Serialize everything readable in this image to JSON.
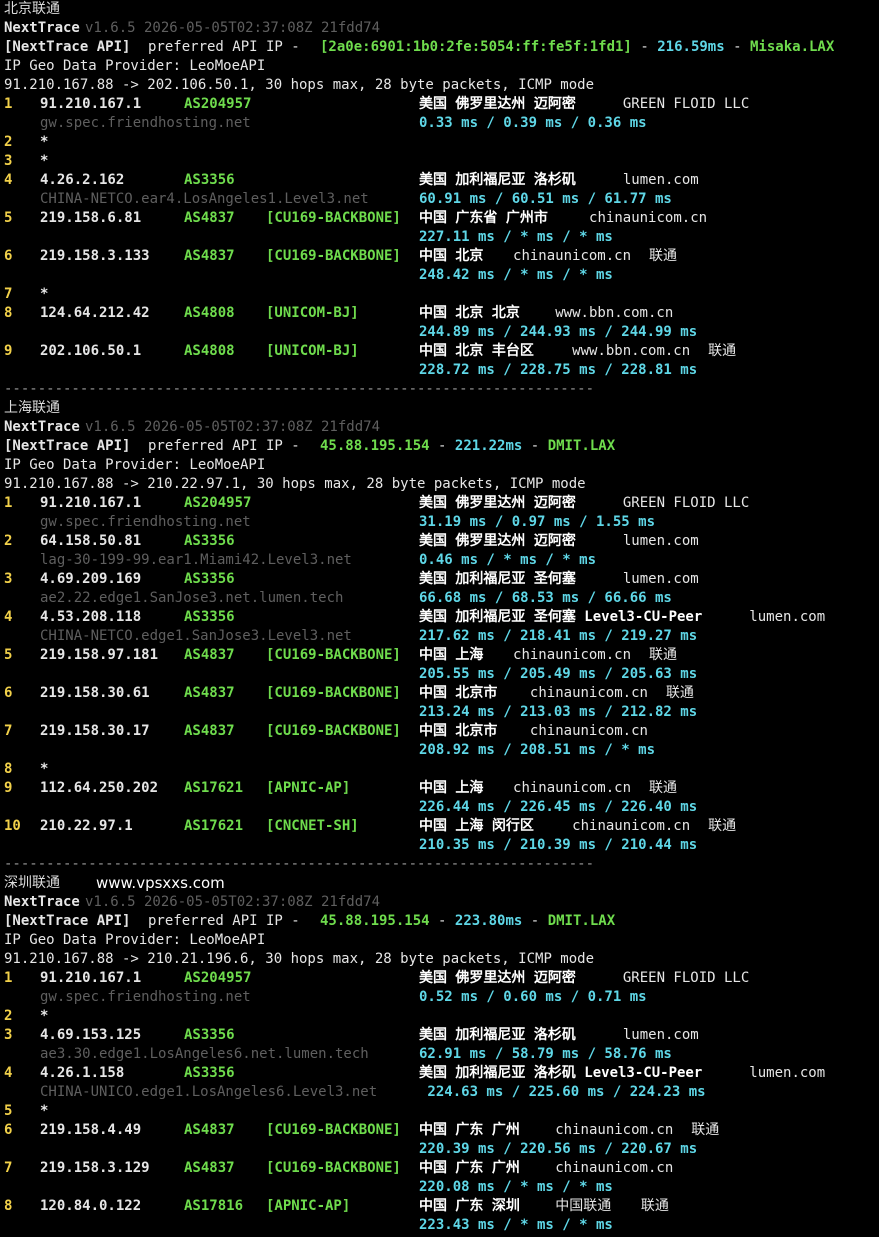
{
  "sections": [
    {
      "title": "北京联通",
      "watermark": "",
      "nt_name": "NextTrace",
      "nt_meta": "v1.6.5 2026-05-05T02:37:08Z 21fdd74",
      "api_label": "[NextTrace API]",
      "api_mid": "preferred API IP -",
      "api_ip": "[2a0e:6901:1b0:2fe:5054:ff:fe5f:1fd1]",
      "api_latency": "216.59ms",
      "api_node": "Misaka.LAX",
      "provider": "IP Geo Data Provider: LeoMoeAPI",
      "trace_line": "91.210.167.88 -> 202.106.50.1, 30 hops max, 28 byte packets, ICMP mode",
      "hops": [
        {
          "n": "1",
          "ip": "91.210.167.1",
          "asn": "AS204957",
          "tag": "",
          "geo": "美国 佛罗里达州 迈阿密",
          "org": "GREEN FLOID LLC",
          "isp": "",
          "rdns": "gw.spec.friendhosting.net",
          "rtt": "0.33 ms / 0.39 ms / 0.36 ms"
        },
        {
          "n": "2",
          "ip": "*"
        },
        {
          "n": "3",
          "ip": "*"
        },
        {
          "n": "4",
          "ip": "4.26.2.162",
          "asn": "AS3356",
          "tag": "",
          "geo": "美国 加利福尼亚 洛杉矶",
          "org": "lumen.com",
          "isp": "",
          "rdns": "CHINA-NETCO.ear4.LosAngeles1.Level3.net",
          "rtt": "60.91 ms / 60.51 ms / 61.77 ms"
        },
        {
          "n": "5",
          "ip": "219.158.6.81",
          "asn": "AS4837",
          "tag": "[CU169-BACKBONE]",
          "geo": "中国 广东省 广州市",
          "org": "chinaunicom.cn",
          "isp": "",
          "rdns": "",
          "rtt": "227.11 ms / * ms / * ms"
        },
        {
          "n": "6",
          "ip": "219.158.3.133",
          "asn": "AS4837",
          "tag": "[CU169-BACKBONE]",
          "geo": "中国 北京",
          "org": "chinaunicom.cn",
          "isp": "联通",
          "rdns": "",
          "rtt": "248.42 ms / * ms / * ms"
        },
        {
          "n": "7",
          "ip": "*"
        },
        {
          "n": "8",
          "ip": "124.64.212.42",
          "asn": "AS4808",
          "tag": "[UNICOM-BJ]",
          "geo": "中国 北京 北京",
          "org": "www.bbn.com.cn",
          "isp": "",
          "rdns": "",
          "rtt": "244.89 ms / 244.93 ms / 244.99 ms"
        },
        {
          "n": "9",
          "ip": "202.106.50.1",
          "asn": "AS4808",
          "tag": "[UNICOM-BJ]",
          "geo": "中国 北京 丰台区",
          "org": "www.bbn.com.cn",
          "isp": "联通",
          "rdns": "",
          "rtt": "228.72 ms / 228.75 ms / 228.81 ms"
        }
      ]
    },
    {
      "title": "上海联通",
      "watermark": "",
      "nt_name": "NextTrace",
      "nt_meta": "v1.6.5 2026-05-05T02:37:08Z 21fdd74",
      "api_label": "[NextTrace API]",
      "api_mid": "preferred API IP -",
      "api_ip": "45.88.195.154",
      "api_latency": "221.22ms",
      "api_node": "DMIT.LAX",
      "provider": "IP Geo Data Provider: LeoMoeAPI",
      "trace_line": "91.210.167.88 -> 210.22.97.1, 30 hops max, 28 byte packets, ICMP mode",
      "hops": [
        {
          "n": "1",
          "ip": "91.210.167.1",
          "asn": "AS204957",
          "tag": "",
          "geo": "美国 佛罗里达州 迈阿密",
          "org": "GREEN FLOID LLC",
          "isp": "",
          "rdns": "gw.spec.friendhosting.net",
          "rtt": "31.19 ms / 0.97 ms / 1.55 ms"
        },
        {
          "n": "2",
          "ip": "64.158.50.81",
          "asn": "AS3356",
          "tag": "",
          "geo": "美国 佛罗里达州 迈阿密",
          "org": "lumen.com",
          "isp": "",
          "rdns": "lag-30-199-99.ear1.Miami42.Level3.net",
          "rtt": "0.46 ms / * ms / * ms"
        },
        {
          "n": "3",
          "ip": "4.69.209.169",
          "asn": "AS3356",
          "tag": "",
          "geo": "美国 加利福尼亚 圣何塞",
          "org": "lumen.com",
          "isp": "",
          "rdns": "ae2.22.edge1.SanJose3.net.lumen.tech",
          "rtt": "66.68 ms / 68.53 ms / 66.66 ms"
        },
        {
          "n": "4",
          "ip": "4.53.208.118",
          "asn": "AS3356",
          "tag": "",
          "geo": "美国 加利福尼亚 圣何塞 Level3-CU-Peer",
          "org": "lumen.com",
          "isp": "",
          "rdns": "CHINA-NETCO.edge1.SanJose3.Level3.net",
          "rtt": "217.62 ms / 218.41 ms / 219.27 ms"
        },
        {
          "n": "5",
          "ip": "219.158.97.181",
          "asn": "AS4837",
          "tag": "[CU169-BACKBONE]",
          "geo": "中国 上海",
          "org": "chinaunicom.cn",
          "isp": "联通",
          "rdns": "",
          "rtt": "205.55 ms / 205.49 ms / 205.63 ms"
        },
        {
          "n": "6",
          "ip": "219.158.30.61",
          "asn": "AS4837",
          "tag": "[CU169-BACKBONE]",
          "geo": "中国 北京市",
          "org": "chinaunicom.cn",
          "isp": "联通",
          "rdns": "",
          "rtt": "213.24 ms / 213.03 ms / 212.82 ms"
        },
        {
          "n": "7",
          "ip": "219.158.30.17",
          "asn": "AS4837",
          "tag": "[CU169-BACKBONE]",
          "geo": "中国 北京市",
          "org": "chinaunicom.cn",
          "isp": "",
          "rdns": "",
          "rtt": "208.92 ms / 208.51 ms / * ms"
        },
        {
          "n": "8",
          "ip": "*"
        },
        {
          "n": "9",
          "ip": "112.64.250.202",
          "asn": "AS17621",
          "tag": "[APNIC-AP]",
          "geo": "中国 上海",
          "org": "chinaunicom.cn",
          "isp": "联通",
          "rdns": "",
          "rtt": "226.44 ms / 226.45 ms / 226.40 ms"
        },
        {
          "n": "10",
          "ip": "210.22.97.1",
          "asn": "AS17621",
          "tag": "[CNCNET-SH]",
          "geo": "中国 上海 闵行区",
          "org": "chinaunicom.cn",
          "isp": "联通",
          "rdns": "",
          "rtt": "210.35 ms / 210.39 ms / 210.44 ms"
        }
      ]
    },
    {
      "title": "深圳联通",
      "watermark": "www.vpsxxs.com",
      "nt_name": "NextTrace",
      "nt_meta": "v1.6.5 2026-05-05T02:37:08Z 21fdd74",
      "api_label": "[NextTrace API]",
      "api_mid": "preferred API IP -",
      "api_ip": "45.88.195.154",
      "api_latency": "223.80ms",
      "api_node": "DMIT.LAX",
      "provider": "IP Geo Data Provider: LeoMoeAPI",
      "trace_line": "91.210.167.88 -> 210.21.196.6, 30 hops max, 28 byte packets, ICMP mode",
      "hops": [
        {
          "n": "1",
          "ip": "91.210.167.1",
          "asn": "AS204957",
          "tag": "",
          "geo": "美国 佛罗里达州 迈阿密",
          "org": "GREEN FLOID LLC",
          "isp": "",
          "rdns": "gw.spec.friendhosting.net",
          "rtt": "0.52 ms / 0.60 ms / 0.71 ms"
        },
        {
          "n": "2",
          "ip": "*"
        },
        {
          "n": "3",
          "ip": "4.69.153.125",
          "asn": "AS3356",
          "tag": "",
          "geo": "美国 加利福尼亚 洛杉矶",
          "org": "lumen.com",
          "isp": "",
          "rdns": "ae3.30.edge1.LosAngeles6.net.lumen.tech",
          "rtt": "62.91 ms / 58.79 ms / 58.76 ms"
        },
        {
          "n": "4",
          "ip": "4.26.1.158",
          "asn": "AS3356",
          "tag": "",
          "geo": "美国 加利福尼亚 洛杉矶 Level3-CU-Peer",
          "org": "lumen.com",
          "isp": "",
          "rdns": "CHINA-UNICO.edge1.LosAngeles6.Level3.net",
          "rtt": " 224.63 ms / 225.60 ms / 224.23 ms"
        },
        {
          "n": "5",
          "ip": "*"
        },
        {
          "n": "6",
          "ip": "219.158.4.49",
          "asn": "AS4837",
          "tag": "[CU169-BACKBONE]",
          "geo": "中国 广东 广州",
          "org": "chinaunicom.cn",
          "isp": "联通",
          "rdns": "",
          "rtt": "220.39 ms / 220.56 ms / 220.67 ms"
        },
        {
          "n": "7",
          "ip": "219.158.3.129",
          "asn": "AS4837",
          "tag": "[CU169-BACKBONE]",
          "geo": "中国 广东 广州",
          "org": "chinaunicom.cn",
          "isp": "",
          "rdns": "",
          "rtt": "220.08 ms / * ms / * ms"
        },
        {
          "n": "8",
          "ip": "120.84.0.122",
          "asn": "AS17816",
          "tag": "[APNIC-AP]",
          "geo": "中国 广东 深圳",
          "org": "中国联通",
          "isp": "联通",
          "rdns": "",
          "rtt": "223.43 ms / * ms / * ms"
        }
      ]
    }
  ],
  "separator": "----------------------------------------------------------------------"
}
